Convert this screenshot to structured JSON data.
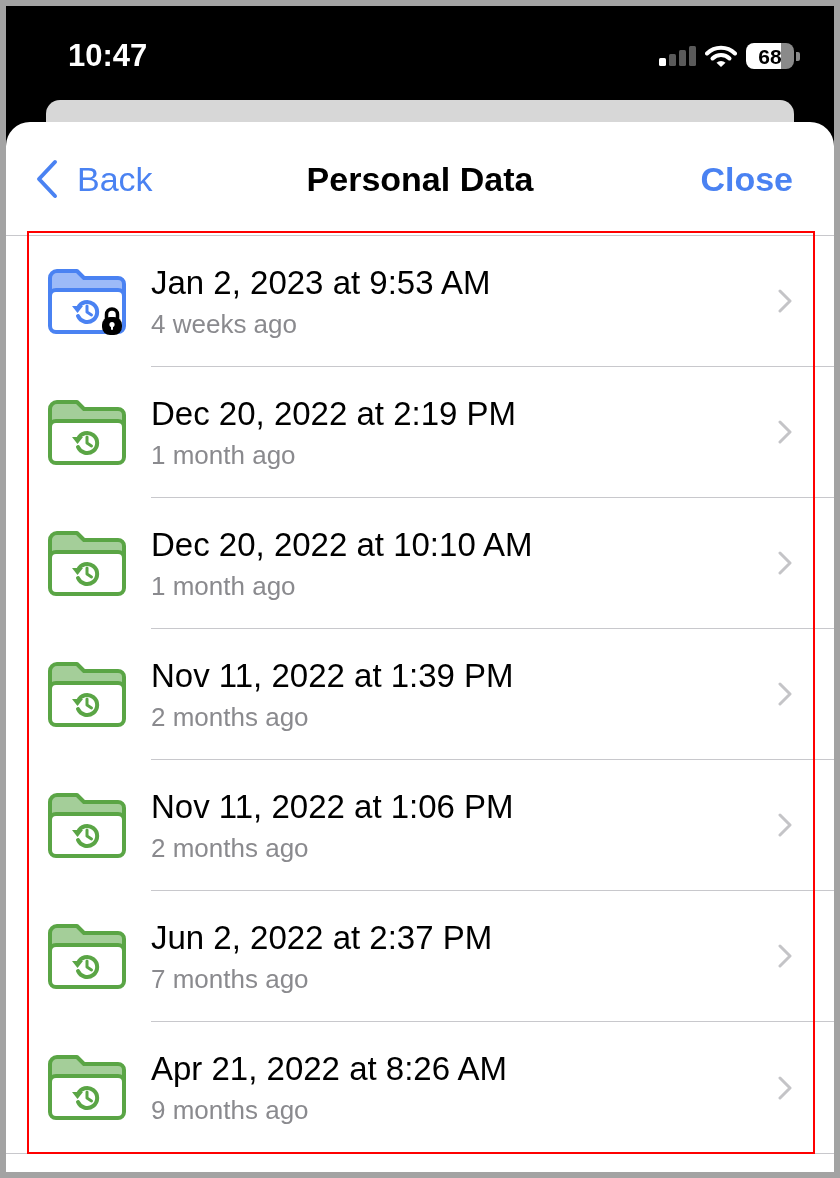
{
  "status_bar": {
    "time": "10:47",
    "battery": "68"
  },
  "nav": {
    "back": "Back",
    "title": "Personal Data",
    "close": "Close"
  },
  "list": {
    "highlighted": true,
    "items": [
      {
        "title": "Jan 2, 2023 at 9:53 AM",
        "subtitle": "4 weeks ago",
        "color": "#4a82f2",
        "locked": true
      },
      {
        "title": "Dec 20, 2022 at 2:19 PM",
        "subtitle": "1 month ago",
        "color": "#5aa545",
        "locked": false
      },
      {
        "title": "Dec 20, 2022 at 10:10 AM",
        "subtitle": "1 month ago",
        "color": "#5aa545",
        "locked": false
      },
      {
        "title": "Nov 11, 2022 at 1:39 PM",
        "subtitle": "2 months ago",
        "color": "#5aa545",
        "locked": false
      },
      {
        "title": "Nov 11, 2022 at 1:06 PM",
        "subtitle": "2 months ago",
        "color": "#5aa545",
        "locked": false
      },
      {
        "title": "Jun 2, 2022 at 2:37 PM",
        "subtitle": "7 months ago",
        "color": "#5aa545",
        "locked": false
      },
      {
        "title": "Apr 21, 2022 at 8:26 AM",
        "subtitle": "9 months ago",
        "color": "#5aa545",
        "locked": false
      }
    ]
  }
}
